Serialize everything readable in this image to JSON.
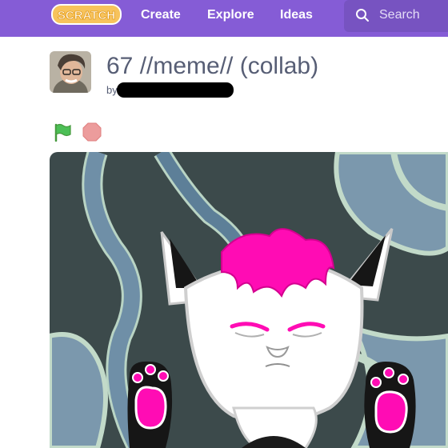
{
  "nav": {
    "logo_text": "SCRATCH",
    "links": [
      "Create",
      "Explore",
      "Ideas"
    ],
    "search_placeholder": "Search"
  },
  "project": {
    "title": "67 //meme// (collab)",
    "by_label": "by"
  },
  "colors": {
    "nav_bg": "#855cd6",
    "title_text": "#575e75",
    "flag": "#4cbf56",
    "stop": "#ec9c9c",
    "accent_pink": "#ff0cb4"
  },
  "icons": [
    "search-icon",
    "green-flag-icon",
    "stop-icon"
  ]
}
